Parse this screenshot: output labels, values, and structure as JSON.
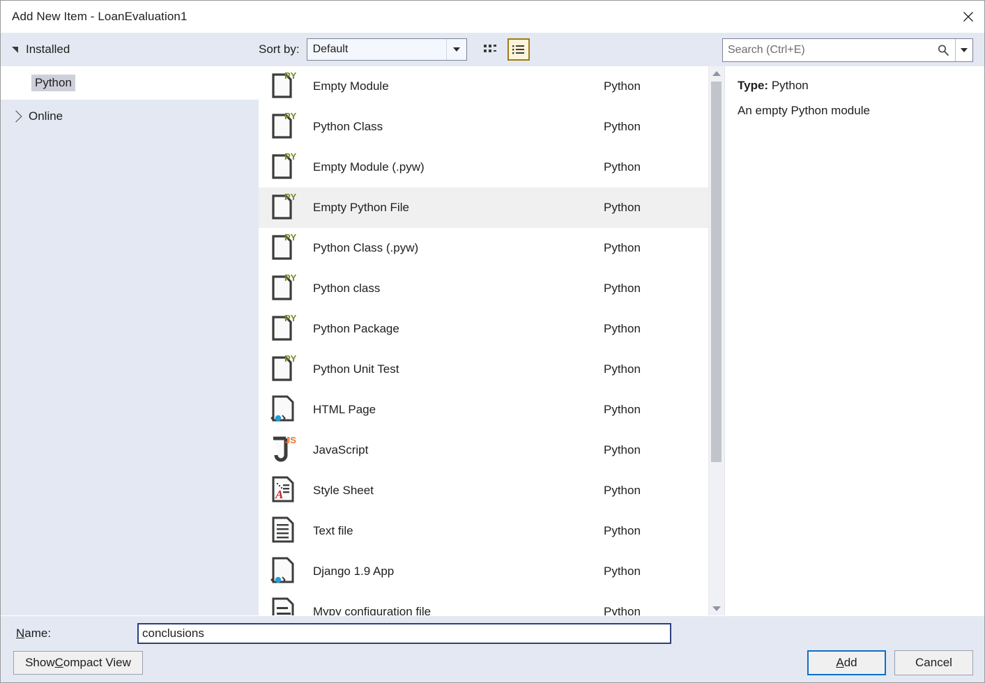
{
  "window": {
    "title": "Add New Item - LoanEvaluation1",
    "close_icon": "close-icon"
  },
  "toolbar": {
    "sort_by_label": "Sort by:",
    "sort_by_value": "Default",
    "sort_by_options": [
      "Default"
    ],
    "grid_view_icon": "grid-view-icon",
    "list_view_icon": "list-view-icon",
    "active_view": "list",
    "search_placeholder": "Search (Ctrl+E)",
    "search_value": "",
    "search_icon": "search-magnifier-icon",
    "search_dropdown_icon": "chevron-down-icon"
  },
  "sidebar": {
    "groups": [
      {
        "label": "Installed",
        "expanded": true,
        "icon": "triangle-down-icon"
      },
      {
        "label": "Online",
        "expanded": false,
        "icon": "triangle-right-icon"
      }
    ],
    "selected_child": "Python"
  },
  "list": {
    "column_category_header": "",
    "selected_index": 3,
    "items": [
      {
        "name": "Empty Module",
        "category": "Python",
        "icon": "python-file-icon"
      },
      {
        "name": "Python Class",
        "category": "Python",
        "icon": "python-file-icon"
      },
      {
        "name": "Empty Module (.pyw)",
        "category": "Python",
        "icon": "python-file-icon"
      },
      {
        "name": "Empty Python File",
        "category": "Python",
        "icon": "python-file-icon"
      },
      {
        "name": "Python Class (.pyw)",
        "category": "Python",
        "icon": "python-file-icon"
      },
      {
        "name": "Python class",
        "category": "Python",
        "icon": "python-file-icon"
      },
      {
        "name": "Python Package",
        "category": "Python",
        "icon": "python-file-icon"
      },
      {
        "name": "Python Unit Test",
        "category": "Python",
        "icon": "python-file-icon"
      },
      {
        "name": "HTML Page",
        "category": "Python",
        "icon": "html-file-icon"
      },
      {
        "name": "JavaScript",
        "category": "Python",
        "icon": "javascript-file-icon"
      },
      {
        "name": "Style Sheet",
        "category": "Python",
        "icon": "stylesheet-file-icon"
      },
      {
        "name": "Text file",
        "category": "Python",
        "icon": "text-file-icon"
      },
      {
        "name": "Django 1.9 App",
        "category": "Python",
        "icon": "html-file-icon"
      },
      {
        "name": "Mypy configuration file",
        "category": "Python",
        "icon": "config-file-icon"
      }
    ],
    "scrollbar": {
      "up_icon": "scroll-up-arrow-icon",
      "down_icon": "scroll-down-arrow-icon",
      "thumb_fraction": 0.73
    }
  },
  "details": {
    "type_label": "Type:",
    "type_value": "Python",
    "description": "An empty Python module"
  },
  "bottom": {
    "name_label_pre": "N",
    "name_label_post": "ame:",
    "name_value": "conclusions",
    "compact_pre": "Show ",
    "compact_accel": "C",
    "compact_post": "ompact View",
    "add_accel": "A",
    "add_post": "dd",
    "cancel_label": "Cancel"
  },
  "colors": {
    "dialog_bg": "#e4e8f2",
    "panel_bg": "#ffffff",
    "selected_row": "#f0f0f0",
    "accent_default_button": "#0a70c8",
    "active_view_border": "#9d7b16",
    "active_view_fill": "#fdf4d9",
    "python_tag": "#6f8c1f",
    "js_tag": "#f07024",
    "css_tag": "#c7252c",
    "html_dot": "#1e9fe0",
    "name_field_border": "#2f3f7c"
  }
}
